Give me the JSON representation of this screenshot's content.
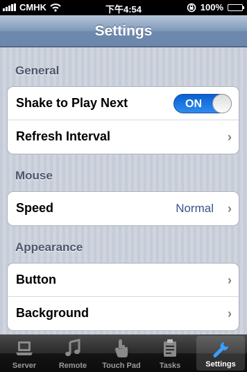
{
  "status_bar": {
    "carrier": "CMHK",
    "time": "下午4:54",
    "battery": "100%"
  },
  "nav": {
    "title": "Settings"
  },
  "sections": {
    "general": {
      "header": "General",
      "shake_label": "Shake to Play Next",
      "shake_toggle": "ON",
      "refresh_label": "Refresh Interval"
    },
    "mouse": {
      "header": "Mouse",
      "speed_label": "Speed",
      "speed_value": "Normal"
    },
    "appearance": {
      "header": "Appearance",
      "button_label": "Button",
      "background_label": "Background"
    }
  },
  "tabs": {
    "server": "Server",
    "remote": "Remote",
    "touchpad": "Touch Pad",
    "tasks": "Tasks",
    "settings": "Settings"
  },
  "colors": {
    "accent": "#2d8cf0",
    "value_text": "#385487",
    "active_tab_icon": "#3aa0ff"
  }
}
